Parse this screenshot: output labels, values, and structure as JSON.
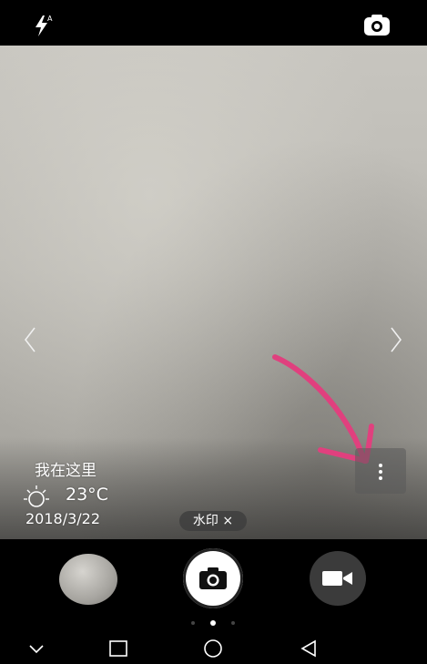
{
  "top_bar": {
    "flash_icon": "flash-auto-icon",
    "switch_icon": "switch-camera-icon"
  },
  "watermark": {
    "location": "我在这里",
    "weather_icon": "sun-icon",
    "temperature": "23°C",
    "date": "2018/3/22"
  },
  "watermark_chip": {
    "label": "水印 ×"
  },
  "controls": {
    "gallery_icon": "gallery-thumbnail",
    "shutter_icon": "camera-icon",
    "video_icon": "video-camera-icon"
  },
  "mode_pager": {
    "count": 3,
    "active_index": 1
  },
  "nav": [
    "chevron-down-icon",
    "recents-icon",
    "home-icon",
    "back-icon"
  ],
  "colors": {
    "annotation": "#e0407e"
  }
}
